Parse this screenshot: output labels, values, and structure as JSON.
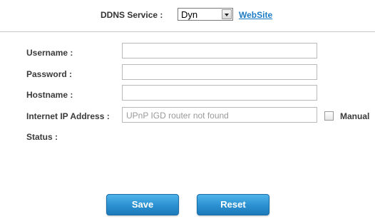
{
  "ddns": {
    "service_label": "DDNS Service :",
    "service_value": "Dyn",
    "website_link": "WebSite"
  },
  "form": {
    "username_label": "Username :",
    "password_label": "Password :",
    "hostname_label": "Hostname :",
    "ip_label": "Internet IP Address :",
    "ip_value": "UPnP IGD router not found",
    "manual_label": "Manual",
    "status_label": "Status :"
  },
  "buttons": {
    "save": "Save",
    "reset": "Reset"
  },
  "colors": {
    "link": "#1a7bc4",
    "button": "#2d93d3"
  }
}
